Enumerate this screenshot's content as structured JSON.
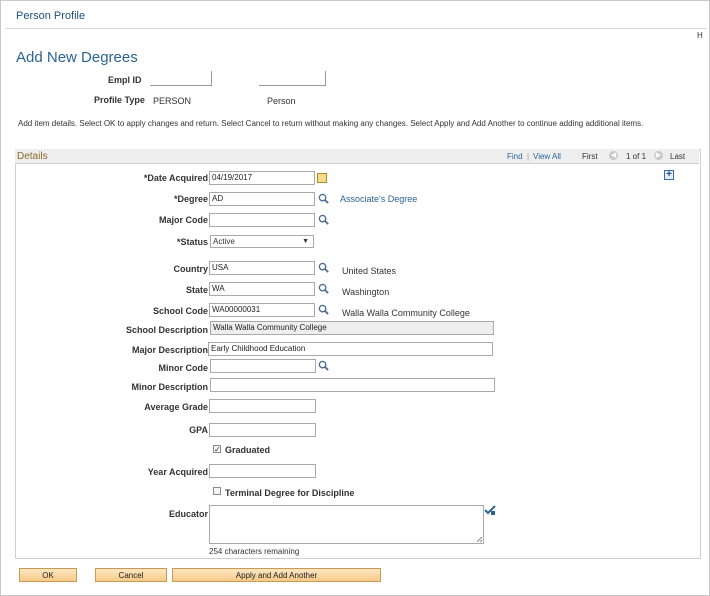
{
  "header": {
    "breadcrumb": "Person Profile",
    "corner": "H"
  },
  "page_title": "Add New Degrees",
  "person": {
    "empl_id_label": "Empl ID",
    "profile_type_label": "Profile Type",
    "profile_type_value": "PERSON",
    "profile_type_desc": "Person"
  },
  "instructions": "Add item details. Select OK to apply changes and return. Select Cancel to return without making any changes. Select Apply and Add Another to continue adding additional items.",
  "details": {
    "title": "Details",
    "find": "Find",
    "separator": "|",
    "view_all": "View All",
    "first": "First",
    "pager": "1 of 1",
    "last": "Last"
  },
  "fields": {
    "date_acquired": {
      "label": "*Date Acquired",
      "value": "04/19/2017"
    },
    "degree": {
      "label": "*Degree",
      "value": "AD",
      "desc": "Associate's Degree"
    },
    "major_code": {
      "label": "Major Code",
      "value": ""
    },
    "status": {
      "label": "*Status",
      "value": "Active"
    },
    "country": {
      "label": "Country",
      "value": "USA",
      "desc": "United States"
    },
    "state": {
      "label": "State",
      "value": "WA",
      "desc": "Washington"
    },
    "school_code": {
      "label": "School Code",
      "value": "WA00000031",
      "desc": "Walla Walla Community College"
    },
    "school_description": {
      "label": "School Description",
      "value": "Walla Walla Community College"
    },
    "major_description": {
      "label": "Major Description",
      "value": "Early Childhood Education"
    },
    "minor_code": {
      "label": "Minor Code",
      "value": ""
    },
    "minor_description": {
      "label": "Minor Description",
      "value": ""
    },
    "average_grade": {
      "label": "Average Grade",
      "value": ""
    },
    "gpa": {
      "label": "GPA",
      "value": ""
    },
    "graduated": {
      "label": "Graduated",
      "checked": true
    },
    "year_acquired": {
      "label": "Year Acquired",
      "value": ""
    },
    "terminal_degree": {
      "label": "Terminal Degree for Discipline",
      "checked": false
    },
    "educator": {
      "label": "Educator",
      "value": "",
      "remaining": "254 characters remaining"
    }
  },
  "buttons": {
    "ok": "OK",
    "cancel": "Cancel",
    "apply_add": "Apply and Add Another"
  },
  "icons": {
    "lookup": "magnifier-icon",
    "calendar": "calendar-icon",
    "spellcheck": "spellcheck-icon",
    "add_row": "plus-icon"
  },
  "colors": {
    "link": "#2a6496",
    "button": "#f7c987",
    "details_title": "#8a6a2a"
  }
}
